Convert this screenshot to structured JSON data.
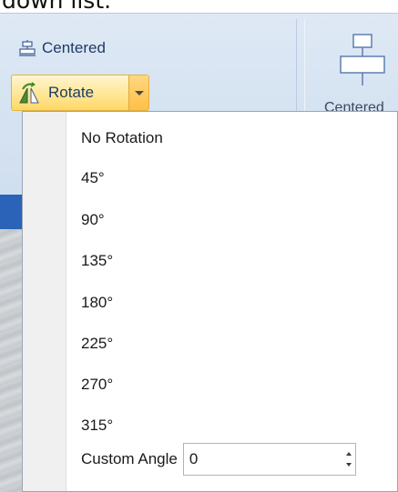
{
  "caption": {
    "text": "down list."
  },
  "ribbon": {
    "centered_label": "Centered",
    "rotate_label": "Rotate",
    "centered_large_label": "Centered"
  },
  "menu": {
    "items": [
      {
        "label": "No Rotation"
      },
      {
        "label": "45°"
      },
      {
        "label": "90°"
      },
      {
        "label": "135°"
      },
      {
        "label": "180°"
      },
      {
        "label": "225°"
      },
      {
        "label": "270°"
      },
      {
        "label": "315°"
      }
    ],
    "custom_angle_label": "Custom Angle",
    "custom_angle_value": "0"
  },
  "icons": {
    "centered_small": "align-center-icon",
    "rotate": "rotate-icon",
    "dropdown": "chevron-down-icon",
    "centered_large": "align-center-large-icon",
    "spin": "spinner-arrows-icon"
  },
  "colors": {
    "ribbon_bg": "#d7e4f2",
    "rotate_highlight": "#ffd766",
    "menu_gutter": "#f0f0f0",
    "band": "#2a63b8"
  }
}
